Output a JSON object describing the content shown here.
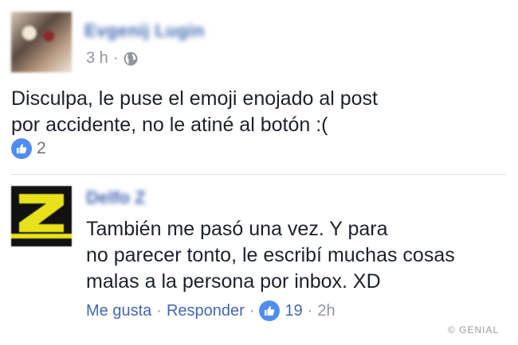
{
  "post": {
    "author_name": "Evgenij Lugin",
    "time": "3 h",
    "separator": "·",
    "text_lines": [
      "Disculpa, le puse el emoji enojado al post",
      "por accidente, no le atiné al botón :("
    ],
    "like_count": "2"
  },
  "comment": {
    "author_name": "Delfo Z",
    "text_lines": [
      "También me pasó una vez. Y para",
      "no parecer tonto, le escribí muchas cosas",
      "malas a la persona por inbox. XD"
    ],
    "like_label": "Me gusta",
    "reply_label": "Responder",
    "separator": "·",
    "like_count": "19",
    "time": "2h"
  },
  "watermark": "© GENIAL",
  "icons": {
    "globe": "globe-icon",
    "like": "like-icon"
  },
  "colors": {
    "link": "#4267b2",
    "meta": "#90949c",
    "like_badge": "#4e8df3"
  }
}
